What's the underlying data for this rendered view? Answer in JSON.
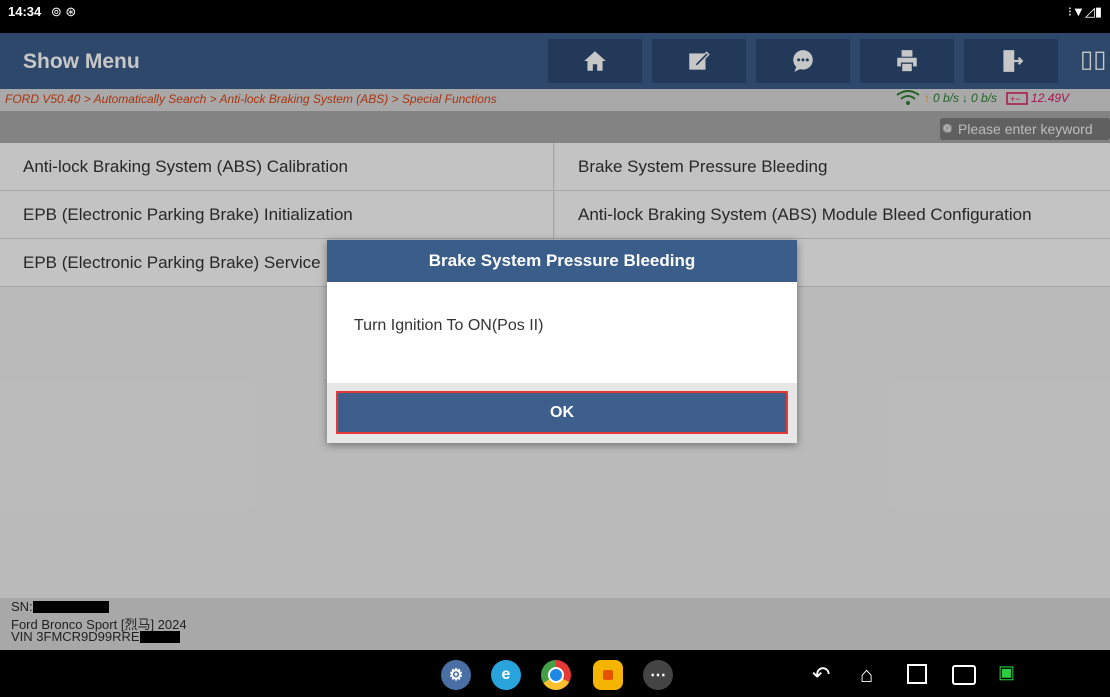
{
  "status_bar": {
    "time": "14:34",
    "left_icons": "⊚ ⊛",
    "right_icons": "⁝▼◿▮"
  },
  "header": {
    "title": "Show Menu",
    "toolbar": [
      {
        "name": "home-button",
        "icon": "home-icon"
      },
      {
        "name": "edit-button",
        "icon": "edit-icon"
      },
      {
        "name": "message-button",
        "icon": "chat-icon"
      },
      {
        "name": "print-button",
        "icon": "print-icon"
      },
      {
        "name": "exit-button",
        "icon": "exit-icon"
      }
    ],
    "split_glyph": "▯▯"
  },
  "breadcrumb": {
    "text": "FORD V50.40 > Automatically Search > Anti-lock Braking System (ABS) > Special Functions"
  },
  "network": {
    "upload": "0 b/s",
    "download": "0 b/s",
    "battery_voltage": "12.49V"
  },
  "search": {
    "placeholder": "Please enter keyword"
  },
  "functions": {
    "left": [
      "Anti-lock Braking System (ABS) Calibration",
      "EPB (Electronic Parking Brake) Initialization",
      "EPB (Electronic Parking Brake) Service"
    ],
    "right": [
      "Brake System Pressure Bleeding",
      "Anti-lock Braking System (ABS) Module Bleed Configuration",
      ""
    ]
  },
  "dialog": {
    "title": "Brake System Pressure Bleeding",
    "message": "Turn Ignition To ON(Pos II)",
    "ok_label": "OK"
  },
  "vehicle_info": {
    "sn_label": "SN:",
    "model": "Ford Bronco Sport [烈马] 2024",
    "vin_prefix": "VIN 3FMCR9D99RRE"
  },
  "colors": {
    "header_blue": "#3a5d8a",
    "breadcrumb_orange": "#d84315",
    "network_green": "#2e7d32",
    "ok_border_red": "#e53935"
  }
}
